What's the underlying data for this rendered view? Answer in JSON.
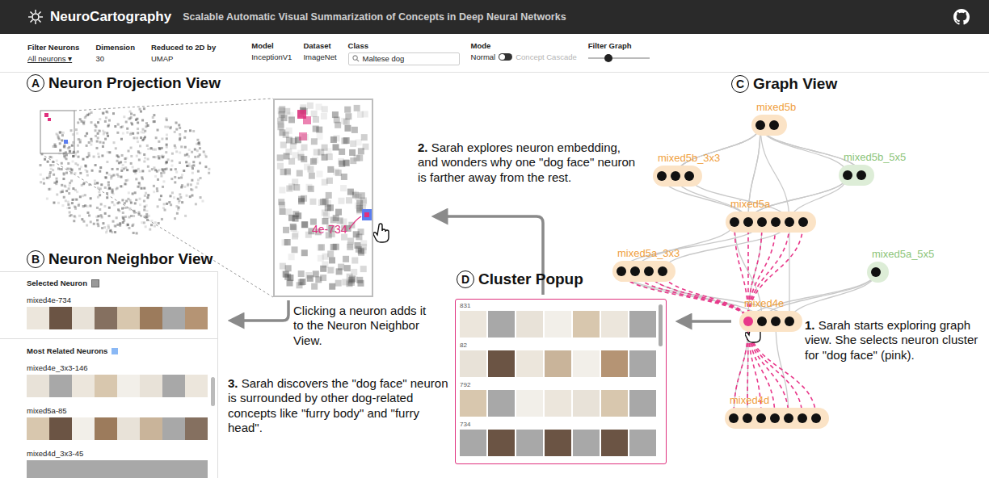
{
  "app": {
    "title": "NeuroCartography",
    "subtitle": "Scalable Automatic Visual Summarization of Concepts in Deep Neural Networks"
  },
  "embedding_controls": [
    {
      "label": "Filter Neurons",
      "value": "All neurons ▾",
      "kind": "dropdown"
    },
    {
      "label": "Dimension",
      "value": "30",
      "kind": "text"
    },
    {
      "label": "Reduced to 2D by",
      "value": "UMAP",
      "kind": "text"
    }
  ],
  "model_controls": [
    {
      "label": "Model",
      "value": "InceptionV1",
      "kind": "text"
    },
    {
      "label": "Dataset",
      "value": "ImageNet",
      "kind": "text"
    }
  ],
  "class_search": {
    "label": "Class",
    "value": "Maltese dog"
  },
  "mode": {
    "label": "Mode",
    "options": [
      {
        "label": "Normal",
        "selected": true
      },
      {
        "label": "Concept Cascade",
        "selected": false
      }
    ]
  },
  "filter_graph": {
    "label": "Filter Graph",
    "level": 0.33
  },
  "projection_view": {
    "badge": "A",
    "title": "Neuron Projection View",
    "zoom_label": "4e-734"
  },
  "neighbor_view": {
    "badge": "B",
    "title": "Neuron Neighbor View",
    "selected_heading": "Selected Neuron",
    "selected_neuron": "mixed4e-734",
    "related_heading": "Most Related Neurons",
    "related_neurons": [
      "mixed4e_3x3-146",
      "mixed5a-85",
      "mixed4d_3x3-45"
    ]
  },
  "graph_view": {
    "badge": "C",
    "title": "Graph View",
    "layers": [
      {
        "name": "mixed5b",
        "color": "#f0a040",
        "nodes": [
          {
            "selected": false
          },
          {
            "selected": false
          }
        ]
      },
      {
        "name": "mixed5b_3x3",
        "color": "#f0a040",
        "nodes": [
          {
            "selected": false
          },
          {
            "selected": false
          },
          {
            "selected": false
          }
        ]
      },
      {
        "name": "mixed5b_5x5",
        "color": "#8cc47a",
        "nodes": [
          {
            "selected": false
          },
          {
            "selected": false
          }
        ]
      },
      {
        "name": "mixed5a",
        "color": "#f0a040",
        "nodes": [
          {
            "selected": false
          },
          {
            "selected": false
          },
          {
            "selected": false
          },
          {
            "selected": false
          },
          {
            "selected": false
          },
          {
            "selected": false
          }
        ]
      },
      {
        "name": "mixed5a_3x3",
        "color": "#f0a040",
        "nodes": [
          {
            "selected": false
          },
          {
            "selected": false
          },
          {
            "selected": false
          },
          {
            "selected": false
          }
        ]
      },
      {
        "name": "mixed5a_5x5",
        "color": "#8cc47a",
        "nodes": [
          {
            "selected": false
          }
        ]
      },
      {
        "name": "mixed4e",
        "color": "#f0a040",
        "nodes": [
          {
            "selected": true
          },
          {
            "selected": false
          },
          {
            "selected": false
          },
          {
            "selected": false
          }
        ]
      },
      {
        "name": "mixed4d",
        "color": "#f0a040",
        "nodes": [
          {
            "selected": false
          },
          {
            "selected": false
          },
          {
            "selected": false
          },
          {
            "selected": false
          },
          {
            "selected": false
          },
          {
            "selected": false
          },
          {
            "selected": false
          }
        ]
      }
    ],
    "edges": [
      {
        "from": "mixed5b",
        "to": "mixed5b_3x3",
        "highlighted": false
      },
      {
        "from": "mixed5b",
        "to": "mixed5b_5x5",
        "highlighted": false
      },
      {
        "from": "mixed5b",
        "to": "mixed5a",
        "highlighted": false
      },
      {
        "from": "mixed5b_3x3",
        "to": "mixed5a",
        "highlighted": false
      },
      {
        "from": "mixed5b_5x5",
        "to": "mixed5a",
        "highlighted": false
      },
      {
        "from": "mixed5a",
        "to": "mixed5a_3x3",
        "highlighted": false
      },
      {
        "from": "mixed5a",
        "to": "mixed4e",
        "highlighted": true
      },
      {
        "from": "mixed5a_3x3",
        "to": "mixed4e",
        "highlighted": true
      },
      {
        "from": "mixed5a_5x5",
        "to": "mixed4e",
        "highlighted": false
      },
      {
        "from": "mixed4e",
        "to": "mixed4d",
        "highlighted": true
      }
    ]
  },
  "cluster_popup": {
    "badge": "D",
    "title": "Cluster Popup",
    "clusters": [
      "831",
      "82",
      "792",
      "734"
    ]
  },
  "annotations": [
    {
      "number": "1.",
      "text": "Sarah starts exploring graph view. She selects neuron cluster for \"dog face\" (pink)."
    },
    {
      "number": "2.",
      "text": "Sarah explores neuron embedding, and wonders why one \"dog face\" neuron is farther away from the rest."
    },
    {
      "number": "3.",
      "text": "Sarah discovers the \"dog face\" neuron  is surrounded by other dog-related concepts like \"furry body\" and \"furry head\"."
    }
  ],
  "click_note": "Clicking a neuron adds it to the Neuron Neighbor View."
}
